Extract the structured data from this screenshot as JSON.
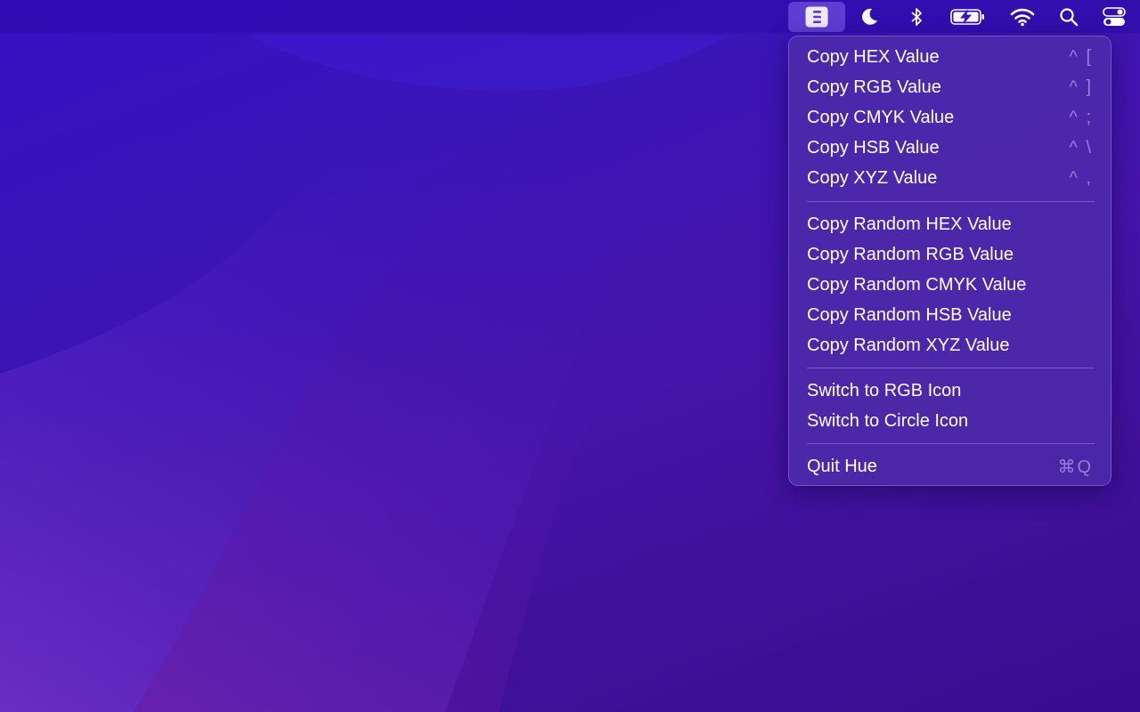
{
  "menubar": {
    "icons": [
      "hue-app-icon",
      "moon-icon",
      "bluetooth-icon",
      "battery-charging-icon",
      "wifi-icon",
      "search-icon",
      "control-center-icon"
    ]
  },
  "menu": {
    "group1": [
      {
        "label": "Copy HEX Value",
        "shortcut": "^ ["
      },
      {
        "label": "Copy RGB Value",
        "shortcut": "^ ]"
      },
      {
        "label": "Copy CMYK Value",
        "shortcut": "^ ;"
      },
      {
        "label": "Copy HSB Value",
        "shortcut": "^ \\"
      },
      {
        "label": "Copy XYZ Value",
        "shortcut": "^ ,"
      }
    ],
    "group2": [
      {
        "label": "Copy Random HEX Value"
      },
      {
        "label": "Copy Random RGB Value"
      },
      {
        "label": "Copy Random CMYK Value"
      },
      {
        "label": "Copy Random HSB Value"
      },
      {
        "label": "Copy Random XYZ Value"
      }
    ],
    "group3": [
      {
        "label": "Switch to RGB Icon"
      },
      {
        "label": "Switch to Circle Icon"
      }
    ],
    "group4": [
      {
        "label": "Quit Hue",
        "shortcut": "⌘Q"
      }
    ]
  },
  "colors": {
    "accent": "#9678ff",
    "menu_bg": "#4e2caa",
    "desktop": "#3a14b8"
  }
}
